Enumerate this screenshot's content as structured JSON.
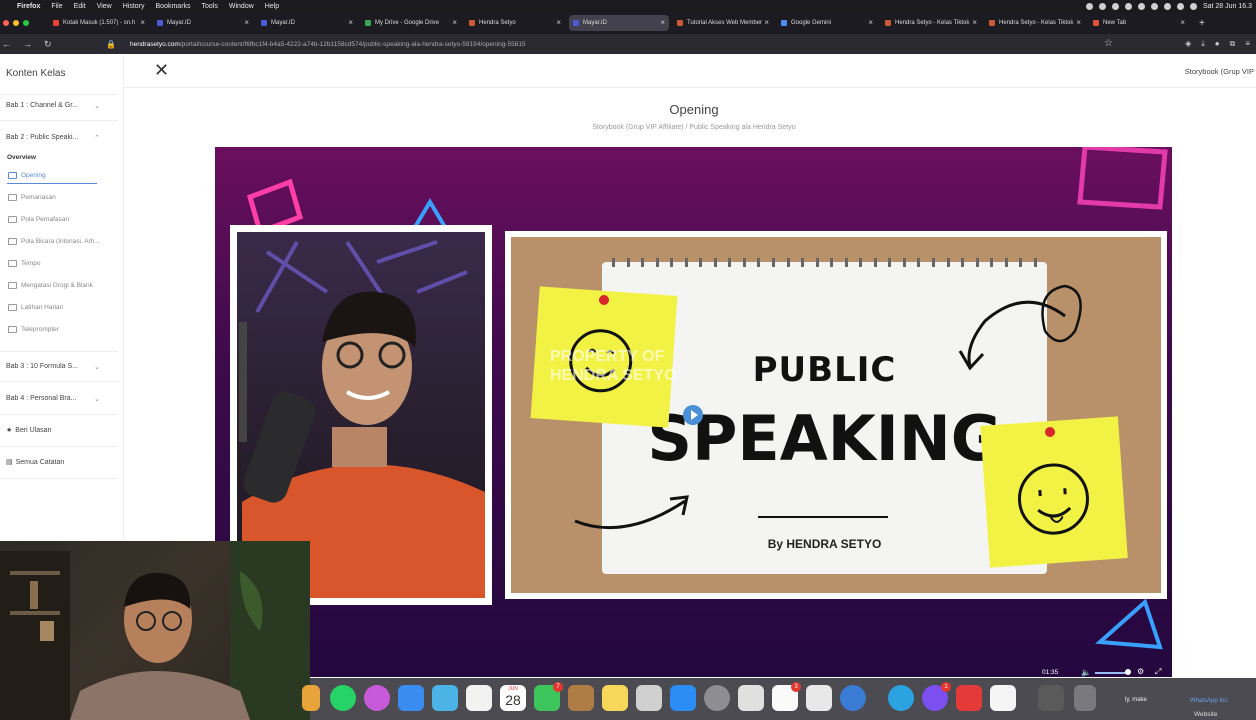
{
  "menubar": {
    "items": [
      "Firefox",
      "File",
      "Edit",
      "View",
      "History",
      "Bookmarks",
      "Tools",
      "Window",
      "Help"
    ],
    "clock": "Sat 28 Jun 16.3"
  },
  "tabs": [
    {
      "label": "Kotak Masuk (1.507) - sn.h",
      "color": "#ea4335"
    },
    {
      "label": "Mayar.ID",
      "color": "#4b5bd6"
    },
    {
      "label": "Mayar.ID",
      "color": "#4b5bd6"
    },
    {
      "label": "My Drive - Google Drive",
      "color": "#34a853"
    },
    {
      "label": "Hendra Setyo",
      "color": "#c85a3a"
    },
    {
      "label": "Mayar.ID",
      "color": "#4b5bd6",
      "active": true
    },
    {
      "label": "Tutorial Akses Web Member",
      "color": "#c85a3a"
    },
    {
      "label": "Google Gemini",
      "color": "#4b8cf5"
    },
    {
      "label": "Hendra Setyo - Kelas Tiktok",
      "color": "#c85a3a"
    },
    {
      "label": "Hendra Setyo - Kelas Tiktok",
      "color": "#c85a3a"
    },
    {
      "label": "New Tab",
      "color": "#e0533b"
    }
  ],
  "url": {
    "domain": "hendrasetyo.com",
    "path": "/portal/course-content/f6fbc1f4-b4a5-4222-a74b-12b1158cd574/public-speaking-ala-hendra-setyo-59194/opening-55815"
  },
  "sidebar": {
    "title": "Konten Kelas",
    "chapters": [
      {
        "label": "Bab 1 : Channel & Gr..."
      },
      {
        "label": "Bab 2 : Public Speaki..."
      },
      {
        "label": "Bab 3 : 10 Formula S..."
      },
      {
        "label": "Bab 4 : Personal Bra..."
      }
    ],
    "overview": "Overview",
    "lessons": [
      "Opening",
      "Pemanasan",
      "Pola Pernafasan",
      "Pola Bicara (Intonasi, Arti...",
      "Tempo",
      "Mengatasi Grogi & Blank",
      "Latihan Harian",
      "Teleprompter"
    ],
    "review": "Beri Ulasan",
    "notes": "Semua Catatan"
  },
  "header": {
    "top_right": "Storybook (Grup VIP",
    "lesson_title": "Opening",
    "breadcrumb": "Storybook (Grup VIP Affiliate) / Public Speaking ala Hendra Setyo"
  },
  "video": {
    "title_line1": "PUBLIC",
    "title_line2": "SPEAKING",
    "byline": "By HENDRA SETYO",
    "watermark_line1": "PROPERTY OF",
    "watermark_line2": "HENDRA SETYO",
    "time": "01:35"
  },
  "dock": {
    "calendar_month": "JUN",
    "calendar_day": "28",
    "badges": [
      "7",
      "3",
      "1"
    ],
    "notification": "ly, make",
    "whatsapp": "WhatsApp Inc.",
    "website": "Website"
  }
}
